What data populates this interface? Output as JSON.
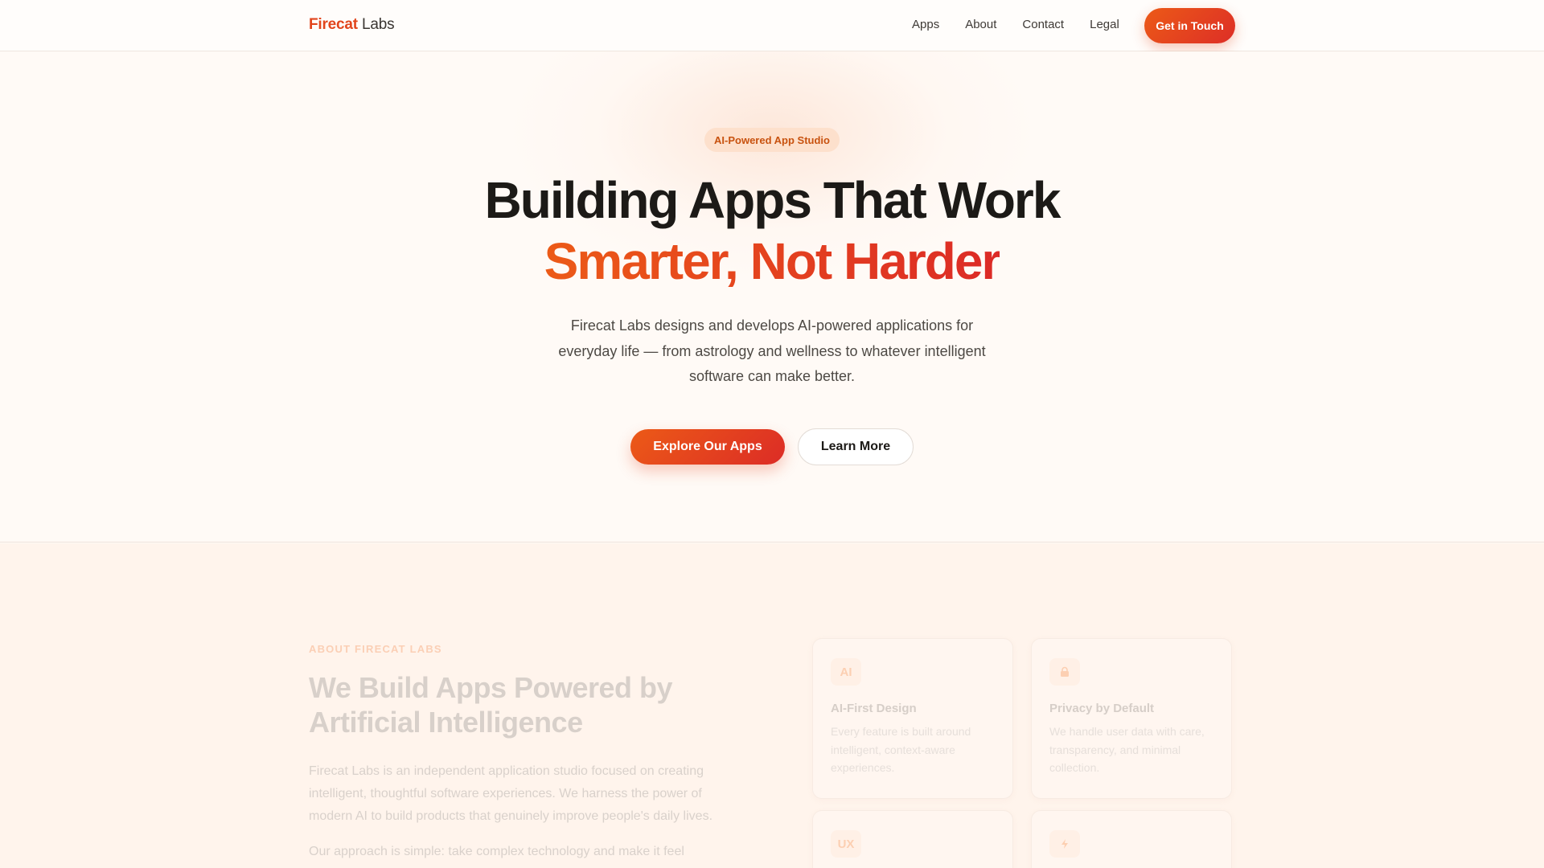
{
  "nav": {
    "brand_accent": "Firecat",
    "brand_rest": " Labs",
    "links": [
      "Apps",
      "About",
      "Contact",
      "Legal"
    ],
    "cta_label": "Get in Touch"
  },
  "hero": {
    "badge": "AI-Powered App Studio",
    "title_line1": "Building Apps That Work",
    "title_line2": "Smarter, Not Harder",
    "description": "Firecat Labs designs and develops AI-powered applications for everyday life — from astrology and wellness to whatever intelligent software can make better.",
    "primary_button": "Explore Our Apps",
    "secondary_button": "Learn More"
  },
  "about": {
    "eyebrow": "ABOUT FIRECAT LABS",
    "title": "We Build Apps Powered by Artificial Intelligence",
    "paragraph1": "Firecat Labs is an independent application studio focused on creating intelligent, thoughtful software experiences. We harness the power of modern AI to build products that genuinely improve people's daily lives.",
    "paragraph2": "Our approach is simple: take complex technology and make it feel",
    "cards": [
      {
        "icon": "AI",
        "icon_name": "ai-icon",
        "title": "AI-First Design",
        "text": "Every feature is built around intelligent, context-aware experiences."
      },
      {
        "icon_name": "lock-icon",
        "title": "Privacy by Default",
        "text": "We handle user data with care, transparency, and minimal collection."
      },
      {
        "icon": "UX",
        "icon_name": "ux-icon",
        "title": "",
        "text": ""
      },
      {
        "icon_name": "bolt-icon",
        "title": "",
        "text": ""
      }
    ]
  },
  "colors": {
    "accent": "#e2451c",
    "accent_gradient_end": "#dc2a26",
    "badge_bg": "#fde0cc",
    "page_bg": "#fffaf6"
  }
}
